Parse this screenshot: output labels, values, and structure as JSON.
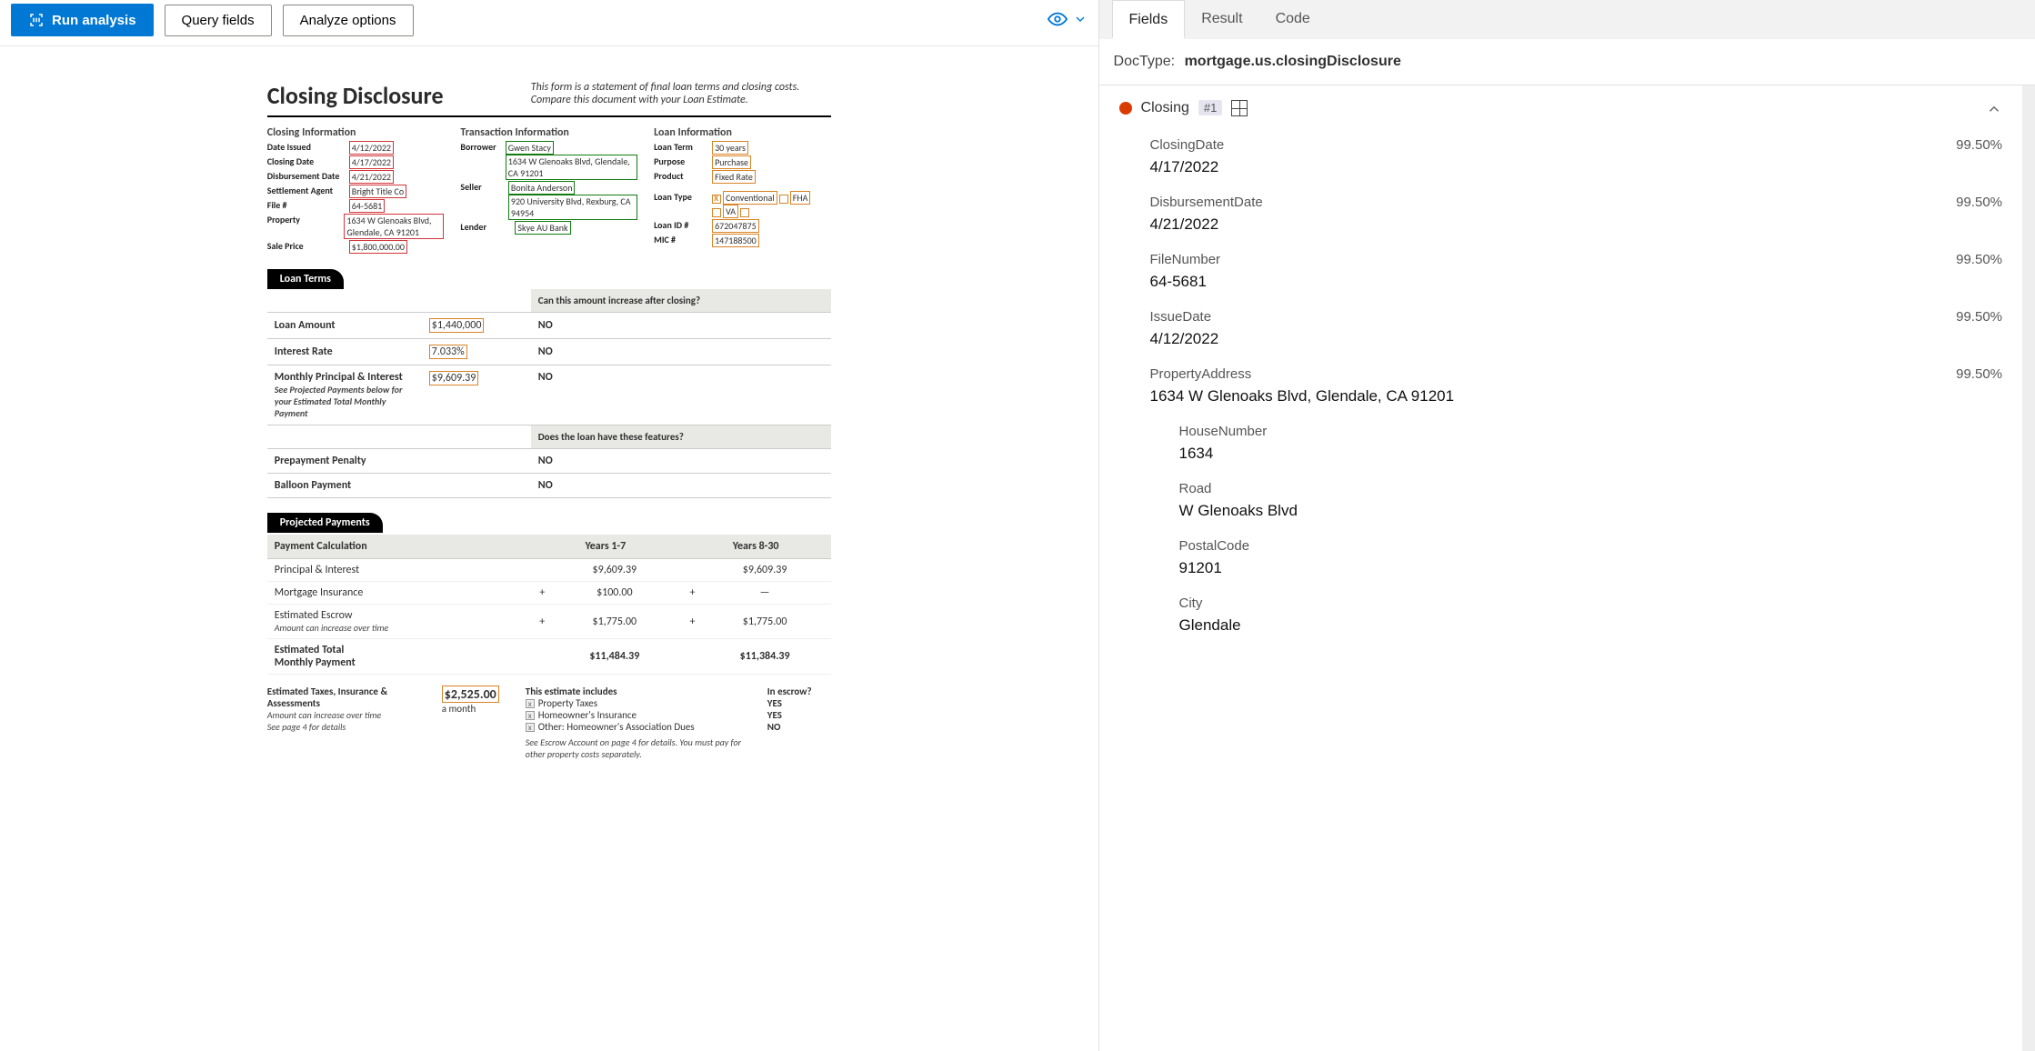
{
  "toolbar": {
    "run": "Run analysis",
    "query": "Query fields",
    "analyze": "Analyze options"
  },
  "document": {
    "title": "Closing Disclosure",
    "intro": "This form is a statement of final loan terms and closing costs. Compare this document with your Loan Estimate.",
    "closingInfo": {
      "heading": "Closing  Information",
      "dateIssuedLabel": "Date Issued",
      "dateIssued": "4/12/2022",
      "closingDateLabel": "Closing Date",
      "closingDate": "4/17/2022",
      "disbursementDateLabel": "Disbursement Date",
      "disbursementDate": "4/21/2022",
      "settlementAgentLabel": "Settlement Agent",
      "settlementAgent": "Bright Title Co",
      "fileNumLabel": "File #",
      "fileNum": "64-5681",
      "propertyLabel": "Property",
      "property": "1634 W Glenoaks Blvd, Glendale, CA 91201",
      "salePriceLabel": "Sale Price",
      "salePrice": "$1,800,000.00"
    },
    "txnInfo": {
      "heading": "Transaction  Information",
      "borrowerLabel": "Borrower",
      "borrowerName": "Gwen Stacy",
      "borrowerAddr": "1634 W Glenoaks Blvd, Glendale, CA 91201",
      "sellerLabel": "Seller",
      "sellerName": "Bonita Anderson",
      "sellerAddr": "920 University Blvd, Rexburg, CA 94954",
      "lenderLabel": "Lender",
      "lender": "Skye AU Bank"
    },
    "loanInfo": {
      "heading": "Loan  Information",
      "loanTermLabel": "Loan Term",
      "loanTerm": "30 years",
      "purposeLabel": "Purpose",
      "purpose": "Purchase",
      "productLabel": "Product",
      "product": "Fixed Rate",
      "loanTypeLabel": "Loan Type",
      "conventional": "Conventional",
      "fha": "FHA",
      "va": "VA",
      "loanIdLabel": "Loan ID #",
      "loanId": "672047875",
      "micLabel": "MIC #",
      "mic": "147188500"
    },
    "loanTerms": {
      "tab": "Loan Terms",
      "q1": "Can this amount increase after closing?",
      "loanAmountLabel": "Loan Amount",
      "loanAmount": "$1,440,000",
      "loanAmountAns": "NO",
      "rateLabel": "Interest Rate",
      "rate": "7.033%",
      "rateAns": "NO",
      "mpiLabel": "Monthly Principal & Interest",
      "mpi": "$9,609.39",
      "mpiAns": "NO",
      "mpiNote": "See Projected Payments below for your Estimated Total Monthly Payment",
      "q2": "Does the loan have these features?",
      "ppLabel": "Prepayment Penalty",
      "ppAns": "NO",
      "bpLabel": "Balloon Payment",
      "bpAns": "NO"
    },
    "projected": {
      "tab": "Projected Payments",
      "calcHeader": "Payment Calculation",
      "col1": "Years 1-7",
      "col2": "Years 8-30",
      "piLabel": "Principal & Interest",
      "pi1": "$9,609.39",
      "pi2": "$9,609.39",
      "miLabel": "Mortgage Insurance",
      "mi1": "$100.00",
      "mi2": "—",
      "escLabel": "Estimated Escrow",
      "escNote": "Amount can increase over time",
      "esc1": "$1,775.00",
      "esc2": "$1,775.00",
      "totLabel1": "Estimated Total",
      "totLabel2": "Monthly Payment",
      "tot1": "$11,484.39",
      "tot2": "$11,384.39"
    },
    "escrow": {
      "leftTitle": "Estimated Taxes, Insurance & Assessments",
      "amount": "$2,525.00",
      "period": "a month",
      "note1": "Amount can increase over time",
      "note2": "See page 4 for details",
      "includesHeader": "This estimate includes",
      "i1": "Property Taxes",
      "i2": "Homeowner's Insurance",
      "i3": "Other: Homeowner's Association Dues",
      "inEscrowHeader": "In escrow?",
      "e1": "YES",
      "e2": "YES",
      "e3": "NO",
      "foot": "See Escrow Account on page 4 for details. You must pay for other property costs separately."
    }
  },
  "right": {
    "tabs": {
      "fields": "Fields",
      "result": "Result",
      "code": "Code"
    },
    "docTypeLabel": "DocType:",
    "docTypeValue": "mortgage.us.closingDisclosure",
    "groupTitle": "Closing",
    "groupBadge": "#1",
    "fields": [
      {
        "label": "ClosingDate",
        "conf": "99.50%",
        "value": "4/17/2022"
      },
      {
        "label": "DisbursementDate",
        "conf": "99.50%",
        "value": "4/21/2022"
      },
      {
        "label": "FileNumber",
        "conf": "99.50%",
        "value": "64-5681"
      },
      {
        "label": "IssueDate",
        "conf": "99.50%",
        "value": "4/12/2022"
      },
      {
        "label": "PropertyAddress",
        "conf": "99.50%",
        "value": "1634 W Glenoaks Blvd, Glendale, CA 91201"
      }
    ],
    "subfields": [
      {
        "label": "HouseNumber",
        "value": "1634"
      },
      {
        "label": "Road",
        "value": "W Glenoaks Blvd"
      },
      {
        "label": "PostalCode",
        "value": "91201"
      },
      {
        "label": "City",
        "value": "Glendale"
      }
    ]
  }
}
